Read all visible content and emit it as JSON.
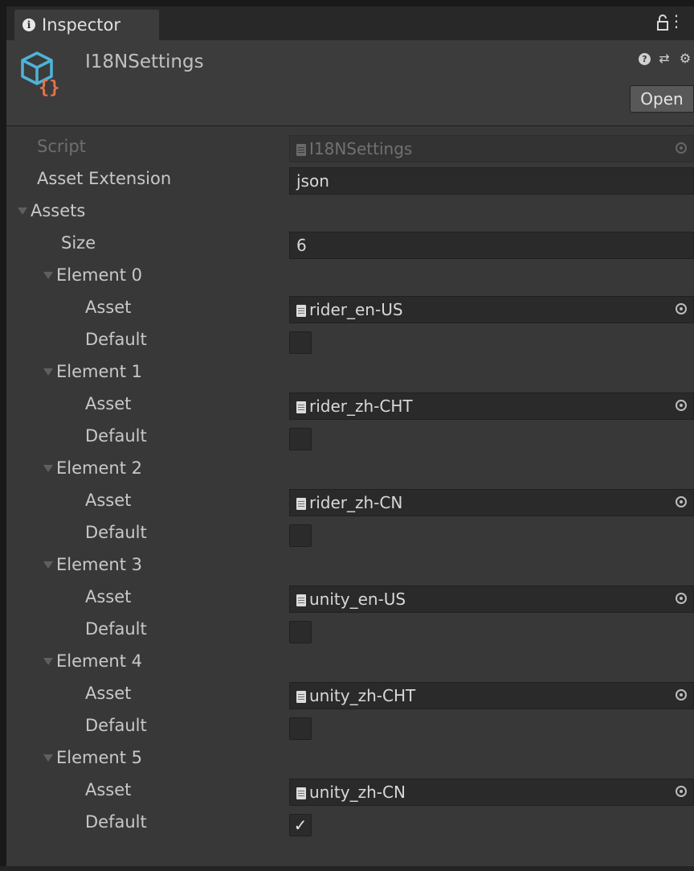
{
  "tab": {
    "label": "Inspector"
  },
  "header": {
    "title": "I18NSettings",
    "open_label": "Open"
  },
  "script_row": {
    "label": "Script",
    "value": "I18NSettings"
  },
  "extension_row": {
    "label": "Asset Extension",
    "value": "json"
  },
  "assets": {
    "label": "Assets",
    "size_label": "Size",
    "size_value": "6",
    "asset_label": "Asset",
    "default_label": "Default",
    "elements": [
      {
        "label": "Element 0",
        "asset": "rider_en-US",
        "default_checked": false
      },
      {
        "label": "Element 1",
        "asset": "rider_zh-CHT",
        "default_checked": false
      },
      {
        "label": "Element 2",
        "asset": "rider_zh-CN",
        "default_checked": false
      },
      {
        "label": "Element 3",
        "asset": "unity_en-US",
        "default_checked": false
      },
      {
        "label": "Element 4",
        "asset": "unity_zh-CHT",
        "default_checked": false
      },
      {
        "label": "Element 5",
        "asset": "unity_zh-CN",
        "default_checked": true
      }
    ]
  },
  "icons": {
    "tab": "info-icon",
    "lock": "lock-icon",
    "menu": "kebab-menu-icon",
    "asset": "scriptable-object-icon",
    "help": "help-icon",
    "presets": "presets-icon",
    "settings": "gear-icon",
    "object_field": "text-asset-icon",
    "picker": "object-picker-icon"
  },
  "colors": {
    "accent_icon_blue": "#4fb3d9",
    "accent_icon_orange": "#e8734a"
  }
}
